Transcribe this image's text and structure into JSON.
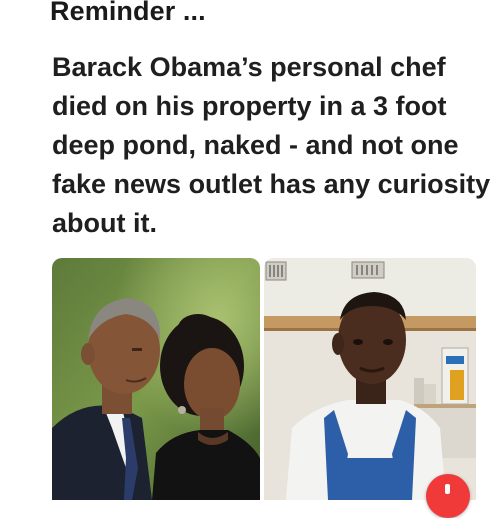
{
  "post": {
    "heading": "Reminder ...",
    "body": "Barack Obama’s personal chef died on his property in a 3 foot deep pond, naked - and not one fake news outlet has any curiosity about it."
  },
  "images": [
    {
      "name": "couple-photo"
    },
    {
      "name": "chef-photo"
    }
  ],
  "badge": {
    "color": "#f03a3a",
    "icon": "record-icon"
  }
}
